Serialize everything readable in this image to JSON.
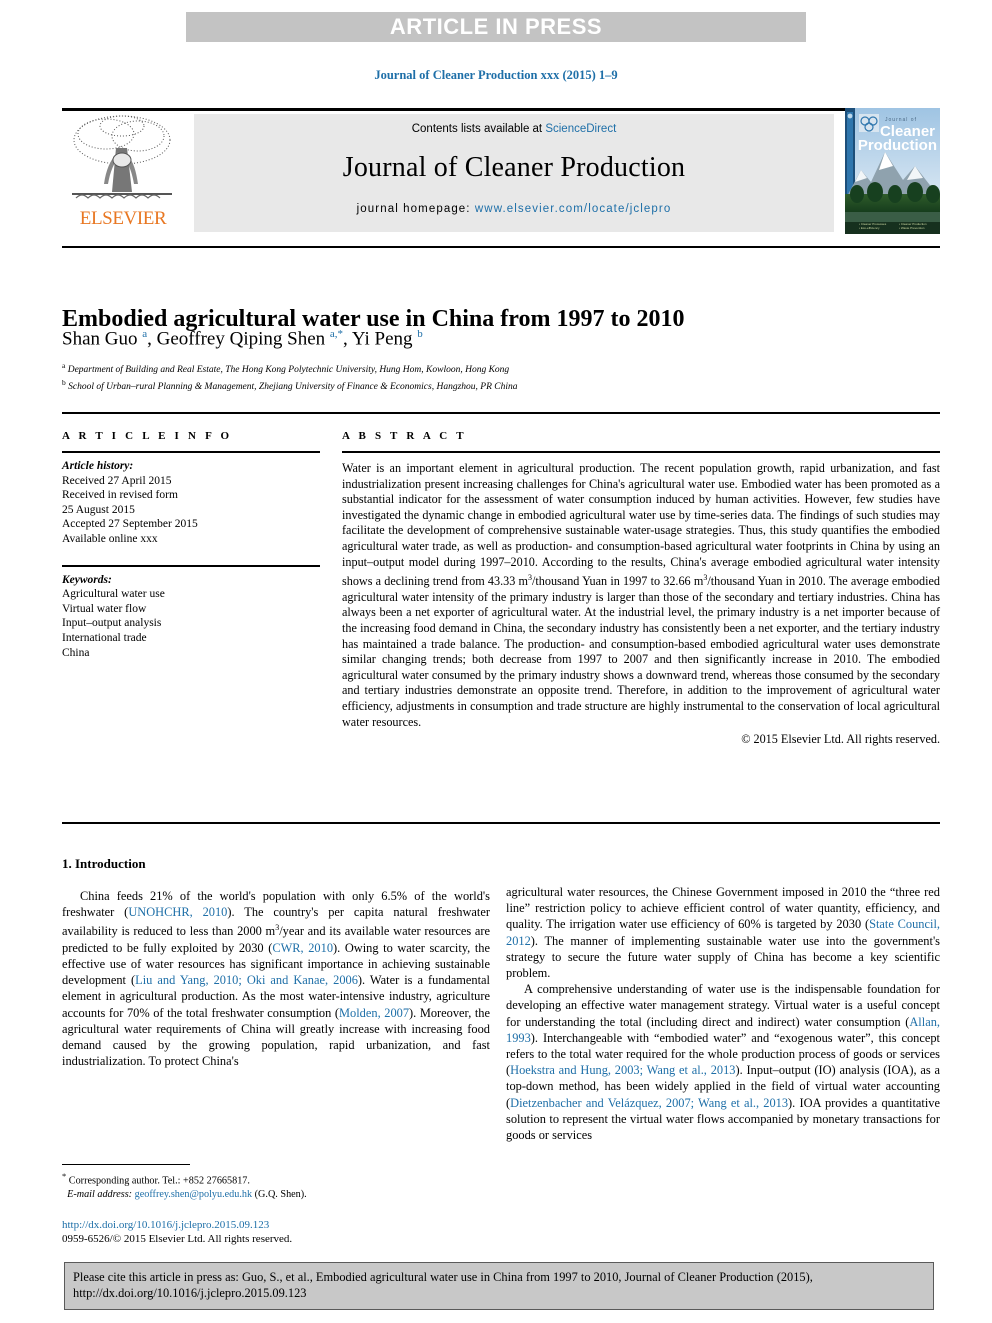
{
  "banner": {
    "text": "ARTICLE IN PRESS"
  },
  "running_head": {
    "text": "Journal of Cleaner Production xxx (2015) 1–9"
  },
  "masthead": {
    "contents_prefix": "Contents lists available at ",
    "sciencedirect": "ScienceDirect",
    "journal_name": "Journal of Cleaner Production",
    "homepage_prefix": "journal homepage: ",
    "homepage_url": "www.elsevier.com/locate/jclepro",
    "publisher": "ELSEVIER",
    "cover_title_small": "Journal of",
    "cover_title_line1": "Cleaner",
    "cover_title_line2": "Production"
  },
  "article": {
    "title": "Embodied agricultural water use in China from 1997 to 2010",
    "authors_html": "Shan Guo <sup>a</sup>, Geoffrey Qiping Shen <sup>a,&#42;</sup>, Yi Peng <sup>b</sup>",
    "affiliation_a": "Department of Building and Real Estate, The Hong Kong Polytechnic University, Hung Hom, Kowloon, Hong Kong",
    "affiliation_b": "School of Urban–rural Planning & Management, Zhejiang University of Finance & Economics, Hangzhou, PR China"
  },
  "info": {
    "heading": "A R T I C L E   I N F O",
    "history_label": "Article history:",
    "history": [
      "Received 27 April 2015",
      "Received in revised form",
      "25 August 2015",
      "Accepted 27 September 2015",
      "Available online xxx"
    ],
    "keywords_label": "Keywords:",
    "keywords": [
      "Agricultural water use",
      "Virtual water flow",
      "Input–output analysis",
      "International trade",
      "China"
    ]
  },
  "abstract": {
    "heading": "A B S T R A C T",
    "body_html": "Water is an important element in agricultural production. The recent population growth, rapid urbanization, and fast industrialization present increasing challenges for China's agricultural water use. Embodied water has been promoted as a substantial indicator for the assessment of water consumption induced by human activities. However, few studies have investigated the dynamic change in embodied agricultural water use by time-series data. The findings of such studies may facilitate the development of comprehensive sustainable water-usage strategies. Thus, this study quantifies the embodied agricultural water trade, as well as production- and consumption-based agricultural water footprints in China by using an input–output model during 1997–2010. According to the results, China's average embodied agricultural water intensity shows a declining trend from 43.33 m<sup class=\"sm\">3</sup>/thousand Yuan in 1997 to 32.66 m<sup class=\"sm\">3</sup>/thousand Yuan in 2010. The average embodied agricultural water intensity of the primary industry is larger than those of the secondary and tertiary industries. China has always been a net exporter of agricultural water. At the industrial level, the primary industry is a net importer because of the increasing food demand in China, the secondary industry has consistently been a net exporter, and the tertiary industry has maintained a trade balance. The production- and consumption-based embodied agricultural water uses demonstrate similar changing trends; both decrease from 1997 to 2007 and then significantly increase in 2010. The embodied agricultural water consumed by the primary industry shows a downward trend, whereas those consumed by the secondary and tertiary industries demonstrate an opposite trend. Therefore, in addition to the improvement of agricultural water efficiency, adjustments in consumption and trade structure are highly instrumental to the conservation of local agricultural water resources.",
    "copyright": "© 2015 Elsevier Ltd. All rights reserved."
  },
  "introduction": {
    "section_title": "1. Introduction",
    "para1_html": "China feeds 21% of the world's population with only 6.5% of the world's freshwater (<span class=\"ref\">UNOHCHR, 2010</span>). The country's per capita natural freshwater availability is reduced to less than 2000 m<sup class=\"sm\">3</sup>/year and its available water resources are predicted to be fully exploited by 2030 (<span class=\"ref\">CWR, 2010</span>). Owing to water scarcity, the effective use of water resources has significant importance in achieving sustainable development (<span class=\"ref\">Liu and Yang, 2010; Oki and Kanae, 2006</span>). Water is a fundamental element in agricultural production. As the most water-intensive industry, agriculture accounts for 70% of the total freshwater consumption (<span class=\"ref\">Molden, 2007</span>). Moreover, the agricultural water requirements of China will greatly increase with increasing food demand caused by the growing population, rapid urbanization, and fast industrialization. To protect China's",
    "para1_cont_html": "agricultural water resources, the Chinese Government imposed in 2010 the “three red line” restriction policy to achieve efficient control of water quantity, efficiency, and quality. The irrigation water use efficiency of 60% is targeted by 2030 (<span class=\"ref\">State Council, 2012</span>). The manner of implementing sustainable water use into the government's strategy to secure the future water supply of China has become a key scientific problem.",
    "para2_html": "A comprehensive understanding of water use is the indispensable foundation for developing an effective water management strategy. Virtual water is a useful concept for understanding the total (including direct and indirect) water consumption (<span class=\"ref\">Allan, 1993</span>). Interchangeable with “embodied water” and “exogenous water”, this concept refers to the total water required for the whole production process of goods or services (<span class=\"ref\">Hoekstra and Hung, 2003; Wang et al., 2013</span>). Input–output (IO) analysis (IOA), as a top-down method, has been widely applied in the field of virtual water accounting (<span class=\"ref\">Dietzenbacher and Velázquez, 2007; Wang et al., 2013</span>). IOA provides a quantitative solution to represent the virtual water flows accompanied by monetary transactions for goods or services"
  },
  "footnote": {
    "corresponding_html": "<sup>*</sup> Corresponding author. Tel.: +852 27665817.",
    "email_label": "E-mail address:",
    "email": "geoffrey.shen@polyu.edu.hk",
    "email_suffix": "(G.Q. Shen).",
    "doi_url": "http://dx.doi.org/10.1016/j.jclepro.2015.09.123",
    "issn_line": "0959-6526/© 2015 Elsevier Ltd. All rights reserved."
  },
  "citation_box": {
    "text": "Please cite this article in press as: Guo, S., et al., Embodied agricultural water use in China from 1997 to 2010, Journal of Cleaner Production (2015), http://dx.doi.org/10.1016/j.jclepro.2015.09.123"
  },
  "colors": {
    "link": "#1e6fa8",
    "banner_bg": "#c3c3c3",
    "masthead_bg": "#e8e8e8",
    "elsevier_orange": "#e87722",
    "cite_box_bg": "#c8c8c8"
  }
}
